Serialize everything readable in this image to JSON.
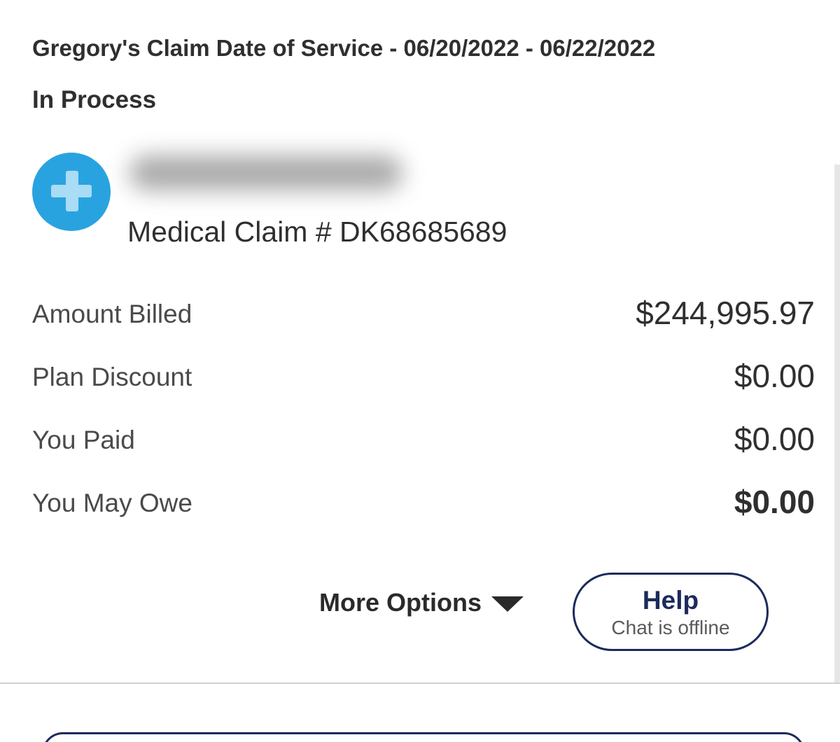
{
  "claim": {
    "title": "Gregory's Claim Date of Service - 06/20/2022 - 06/22/2022",
    "status": "In Process",
    "icon": "medical-cross-icon",
    "claim_number": "Medical Claim # DK68685689"
  },
  "summary": [
    {
      "label": "Amount Billed",
      "value": "$244,995.97"
    },
    {
      "label": "Plan Discount",
      "value": "$0.00"
    },
    {
      "label": "You Paid",
      "value": "$0.00"
    },
    {
      "label": "You May Owe",
      "value": "$0.00"
    }
  ],
  "actions": {
    "more_options_label": "More Options",
    "help_title": "Help",
    "help_subtitle": "Chat is offline"
  },
  "colors": {
    "accent_blue": "#29a3e0",
    "navy": "#1d2a5c",
    "text": "#2f2f2f"
  }
}
